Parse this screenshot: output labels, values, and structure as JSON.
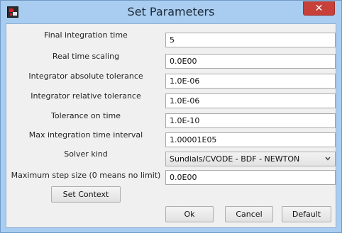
{
  "window": {
    "title": "Set Parameters",
    "close_glyph": "✕",
    "app_icon": "scicos-app-icon"
  },
  "fields": [
    {
      "label": "Final integration time",
      "value": "5"
    },
    {
      "label": "Real time scaling",
      "value": "0.0E00"
    },
    {
      "label": "Integrator absolute tolerance",
      "value": "1.0E-06"
    },
    {
      "label": "Integrator relative tolerance",
      "value": "1.0E-06"
    },
    {
      "label": "Tolerance on time",
      "value": "1.0E-10"
    },
    {
      "label": "Max integration time interval",
      "value": "1.00001E05"
    },
    {
      "label": "Solver kind",
      "value": "Sundials/CVODE - BDF - NEWTON"
    },
    {
      "label": "Maximum step size (0 means no limit)",
      "value": "0.0E00"
    }
  ],
  "buttons": {
    "set_context": "Set Context",
    "ok": "Ok",
    "cancel": "Cancel",
    "default": "Default"
  },
  "colors": {
    "frame": "#a9cdf0",
    "close_button": "#c7403a",
    "client_background": "#f0f0f0"
  }
}
